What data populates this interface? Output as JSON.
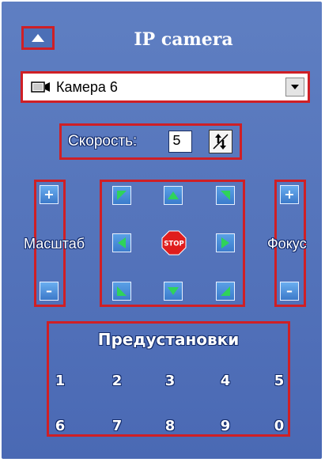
{
  "header": {
    "title": "IP camera",
    "collapse_icon": "triangle-up-icon"
  },
  "camera": {
    "selected": "Камера 6",
    "icon": "camera-icon",
    "dropdown_icon": "chevron-down-icon"
  },
  "speed": {
    "label": "Скорость:",
    "value": "5",
    "spinner_icon": "up-down-arrows-icon"
  },
  "zoom": {
    "label": "Масштаб",
    "plus": "+",
    "minus": "–"
  },
  "focus": {
    "label": "Фокус",
    "plus": "+",
    "minus": "–"
  },
  "ptz": {
    "stop_label": "STOP",
    "buttons": [
      "up-left",
      "up",
      "up-right",
      "left",
      "stop",
      "right",
      "down-left",
      "down",
      "down-right"
    ]
  },
  "presets": {
    "title": "Предустановки",
    "row1": [
      "1",
      "2",
      "3",
      "4",
      "5"
    ],
    "row2": [
      "6",
      "7",
      "8",
      "9",
      "0"
    ]
  },
  "colors": {
    "panel": "#5373bb",
    "highlight": "#cf1f25",
    "button": "#4a8bd8",
    "arrow": "#2fd35a",
    "stop": "#e01d1d"
  }
}
